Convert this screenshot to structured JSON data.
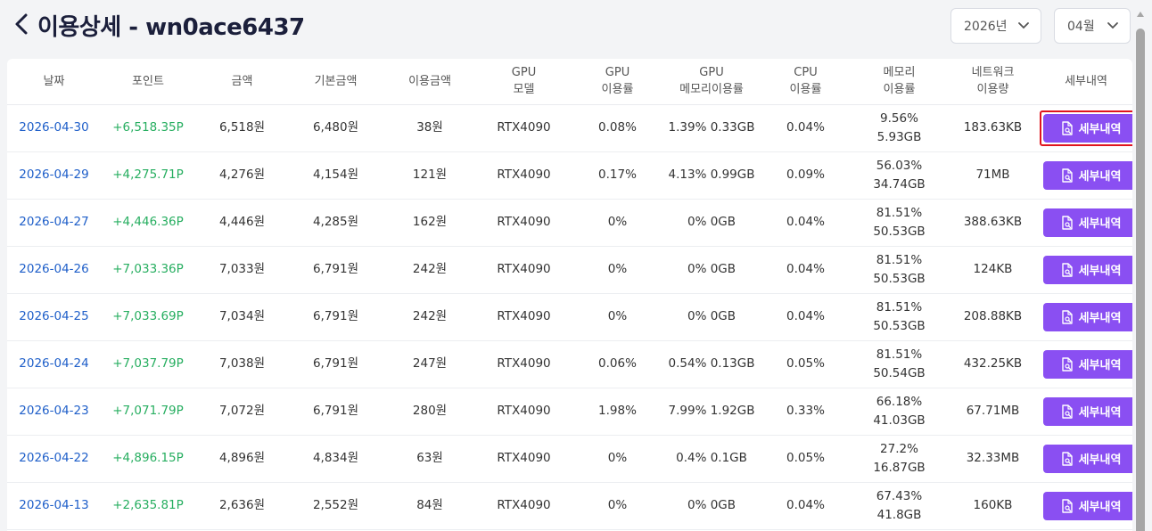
{
  "header": {
    "title": "이용상세 - wn0ace6437",
    "year_select": "2026년",
    "month_select": "04월"
  },
  "table": {
    "headers": [
      {
        "line1": "날짜",
        "line2": ""
      },
      {
        "line1": "포인트",
        "line2": ""
      },
      {
        "line1": "금액",
        "line2": ""
      },
      {
        "line1": "기본금액",
        "line2": ""
      },
      {
        "line1": "이용금액",
        "line2": ""
      },
      {
        "line1": "GPU",
        "line2": "모델"
      },
      {
        "line1": "GPU",
        "line2": "이용률"
      },
      {
        "line1": "GPU",
        "line2": "메모리이용률"
      },
      {
        "line1": "CPU",
        "line2": "이용률"
      },
      {
        "line1": "메모리",
        "line2": "이용률"
      },
      {
        "line1": "네트워크",
        "line2": "이용량"
      },
      {
        "line1": "세부내역",
        "line2": ""
      }
    ],
    "detail_label": "세부내역",
    "rows": [
      {
        "date": "2026-04-30",
        "points": "+6,518.35P",
        "amount": "6,518원",
        "base": "6,480원",
        "usage": "38원",
        "gpu_model": "RTX4090",
        "gpu_util": "0.08%",
        "gpu_mem": "1.39% 0.33GB",
        "cpu": "0.04%",
        "mem": "9.56% 5.93GB",
        "net": "183.63KB"
      },
      {
        "date": "2026-04-29",
        "points": "+4,275.71P",
        "amount": "4,276원",
        "base": "4,154원",
        "usage": "121원",
        "gpu_model": "RTX4090",
        "gpu_util": "0.17%",
        "gpu_mem": "4.13% 0.99GB",
        "cpu": "0.09%",
        "mem": "56.03% 34.74GB",
        "net": "71MB"
      },
      {
        "date": "2026-04-27",
        "points": "+4,446.36P",
        "amount": "4,446원",
        "base": "4,285원",
        "usage": "162원",
        "gpu_model": "RTX4090",
        "gpu_util": "0%",
        "gpu_mem": "0% 0GB",
        "cpu": "0.04%",
        "mem": "81.51% 50.53GB",
        "net": "388.63KB"
      },
      {
        "date": "2026-04-26",
        "points": "+7,033.36P",
        "amount": "7,033원",
        "base": "6,791원",
        "usage": "242원",
        "gpu_model": "RTX4090",
        "gpu_util": "0%",
        "gpu_mem": "0% 0GB",
        "cpu": "0.04%",
        "mem": "81.51% 50.53GB",
        "net": "124KB"
      },
      {
        "date": "2026-04-25",
        "points": "+7,033.69P",
        "amount": "7,034원",
        "base": "6,791원",
        "usage": "242원",
        "gpu_model": "RTX4090",
        "gpu_util": "0%",
        "gpu_mem": "0% 0GB",
        "cpu": "0.04%",
        "mem": "81.51% 50.53GB",
        "net": "208.88KB"
      },
      {
        "date": "2026-04-24",
        "points": "+7,037.79P",
        "amount": "7,038원",
        "base": "6,791원",
        "usage": "247원",
        "gpu_model": "RTX4090",
        "gpu_util": "0.06%",
        "gpu_mem": "0.54% 0.13GB",
        "cpu": "0.05%",
        "mem": "81.51% 50.54GB",
        "net": "432.25KB"
      },
      {
        "date": "2026-04-23",
        "points": "+7,071.79P",
        "amount": "7,072원",
        "base": "6,791원",
        "usage": "280원",
        "gpu_model": "RTX4090",
        "gpu_util": "1.98%",
        "gpu_mem": "7.99% 1.92GB",
        "cpu": "0.33%",
        "mem": "66.18% 41.03GB",
        "net": "67.71MB"
      },
      {
        "date": "2026-04-22",
        "points": "+4,896.15P",
        "amount": "4,896원",
        "base": "4,834원",
        "usage": "63원",
        "gpu_model": "RTX4090",
        "gpu_util": "0%",
        "gpu_mem": "0.4% 0.1GB",
        "cpu": "0.05%",
        "mem": "27.2% 16.87GB",
        "net": "32.33MB"
      },
      {
        "date": "2026-04-13",
        "points": "+2,635.81P",
        "amount": "2,636원",
        "base": "2,552원",
        "usage": "84원",
        "gpu_model": "RTX4090",
        "gpu_util": "0%",
        "gpu_mem": "0% 0GB",
        "cpu": "0.04%",
        "mem": "67.43% 41.8GB",
        "net": "160KB"
      }
    ]
  },
  "colors": {
    "date_link": "#1f5fc9",
    "points": "#27ae60",
    "button": "#8a4ff2",
    "highlight": "#e0141e"
  }
}
